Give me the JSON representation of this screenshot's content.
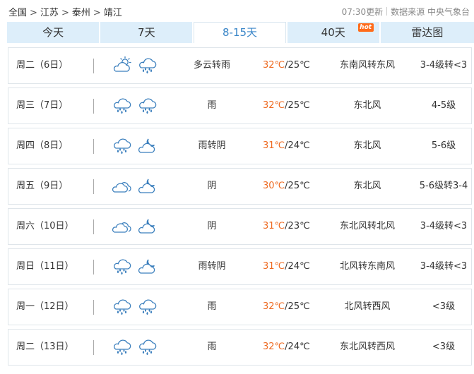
{
  "breadcrumb": [
    "全国",
    "江苏",
    "泰州",
    "靖江"
  ],
  "breadcrumb_sep": ">",
  "update_time": "07:30更新",
  "source": "数据来源 中央气象台",
  "tabs": [
    {
      "label": "今天",
      "active": false
    },
    {
      "label": "7天",
      "active": false
    },
    {
      "label": "8-15天",
      "active": true
    },
    {
      "label": "40天",
      "active": false,
      "badge": "hot"
    },
    {
      "label": "雷达图",
      "active": false
    }
  ],
  "colors": {
    "high_temp": "#ee6a21",
    "accent": "#3a86c8",
    "tab_bg": "#ddeefa",
    "hot_badge": "#ff6b1a"
  },
  "forecast": [
    {
      "day": "周二（6日）",
      "icons": [
        "partly-cloudy-sun-icon",
        "rain-icon"
      ],
      "condition": "多云转雨",
      "high": "32℃",
      "low": "25℃",
      "wind": "东南风转东风",
      "level": "3-4级转<3"
    },
    {
      "day": "周三（7日）",
      "icons": [
        "rain-icon",
        "rain-icon"
      ],
      "condition": "雨",
      "high": "32℃",
      "low": "25℃",
      "wind": "东北风",
      "level": "4-5级"
    },
    {
      "day": "周四（8日）",
      "icons": [
        "rain-icon",
        "overcast-night-icon"
      ],
      "condition": "雨转阴",
      "high": "31℃",
      "low": "24℃",
      "wind": "东北风",
      "level": "5-6级"
    },
    {
      "day": "周五（9日）",
      "icons": [
        "overcast-icon",
        "overcast-night-icon"
      ],
      "condition": "阴",
      "high": "30℃",
      "low": "25℃",
      "wind": "东北风",
      "level": "5-6级转3-4"
    },
    {
      "day": "周六（10日）",
      "icons": [
        "overcast-icon",
        "overcast-night-icon"
      ],
      "condition": "阴",
      "high": "31℃",
      "low": "23℃",
      "wind": "东北风转北风",
      "level": "3-4级转<3"
    },
    {
      "day": "周日（11日）",
      "icons": [
        "rain-icon",
        "overcast-night-icon"
      ],
      "condition": "雨转阴",
      "high": "31℃",
      "low": "24℃",
      "wind": "北风转东南风",
      "level": "3-4级转<3"
    },
    {
      "day": "周一（12日）",
      "icons": [
        "rain-icon",
        "rain-icon"
      ],
      "condition": "雨",
      "high": "32℃",
      "low": "25℃",
      "wind": "北风转西风",
      "level": "<3级"
    },
    {
      "day": "周二（13日）",
      "icons": [
        "rain-icon",
        "rain-icon"
      ],
      "condition": "雨",
      "high": "32℃",
      "low": "24℃",
      "wind": "东北风转西风",
      "level": "<3级"
    }
  ]
}
